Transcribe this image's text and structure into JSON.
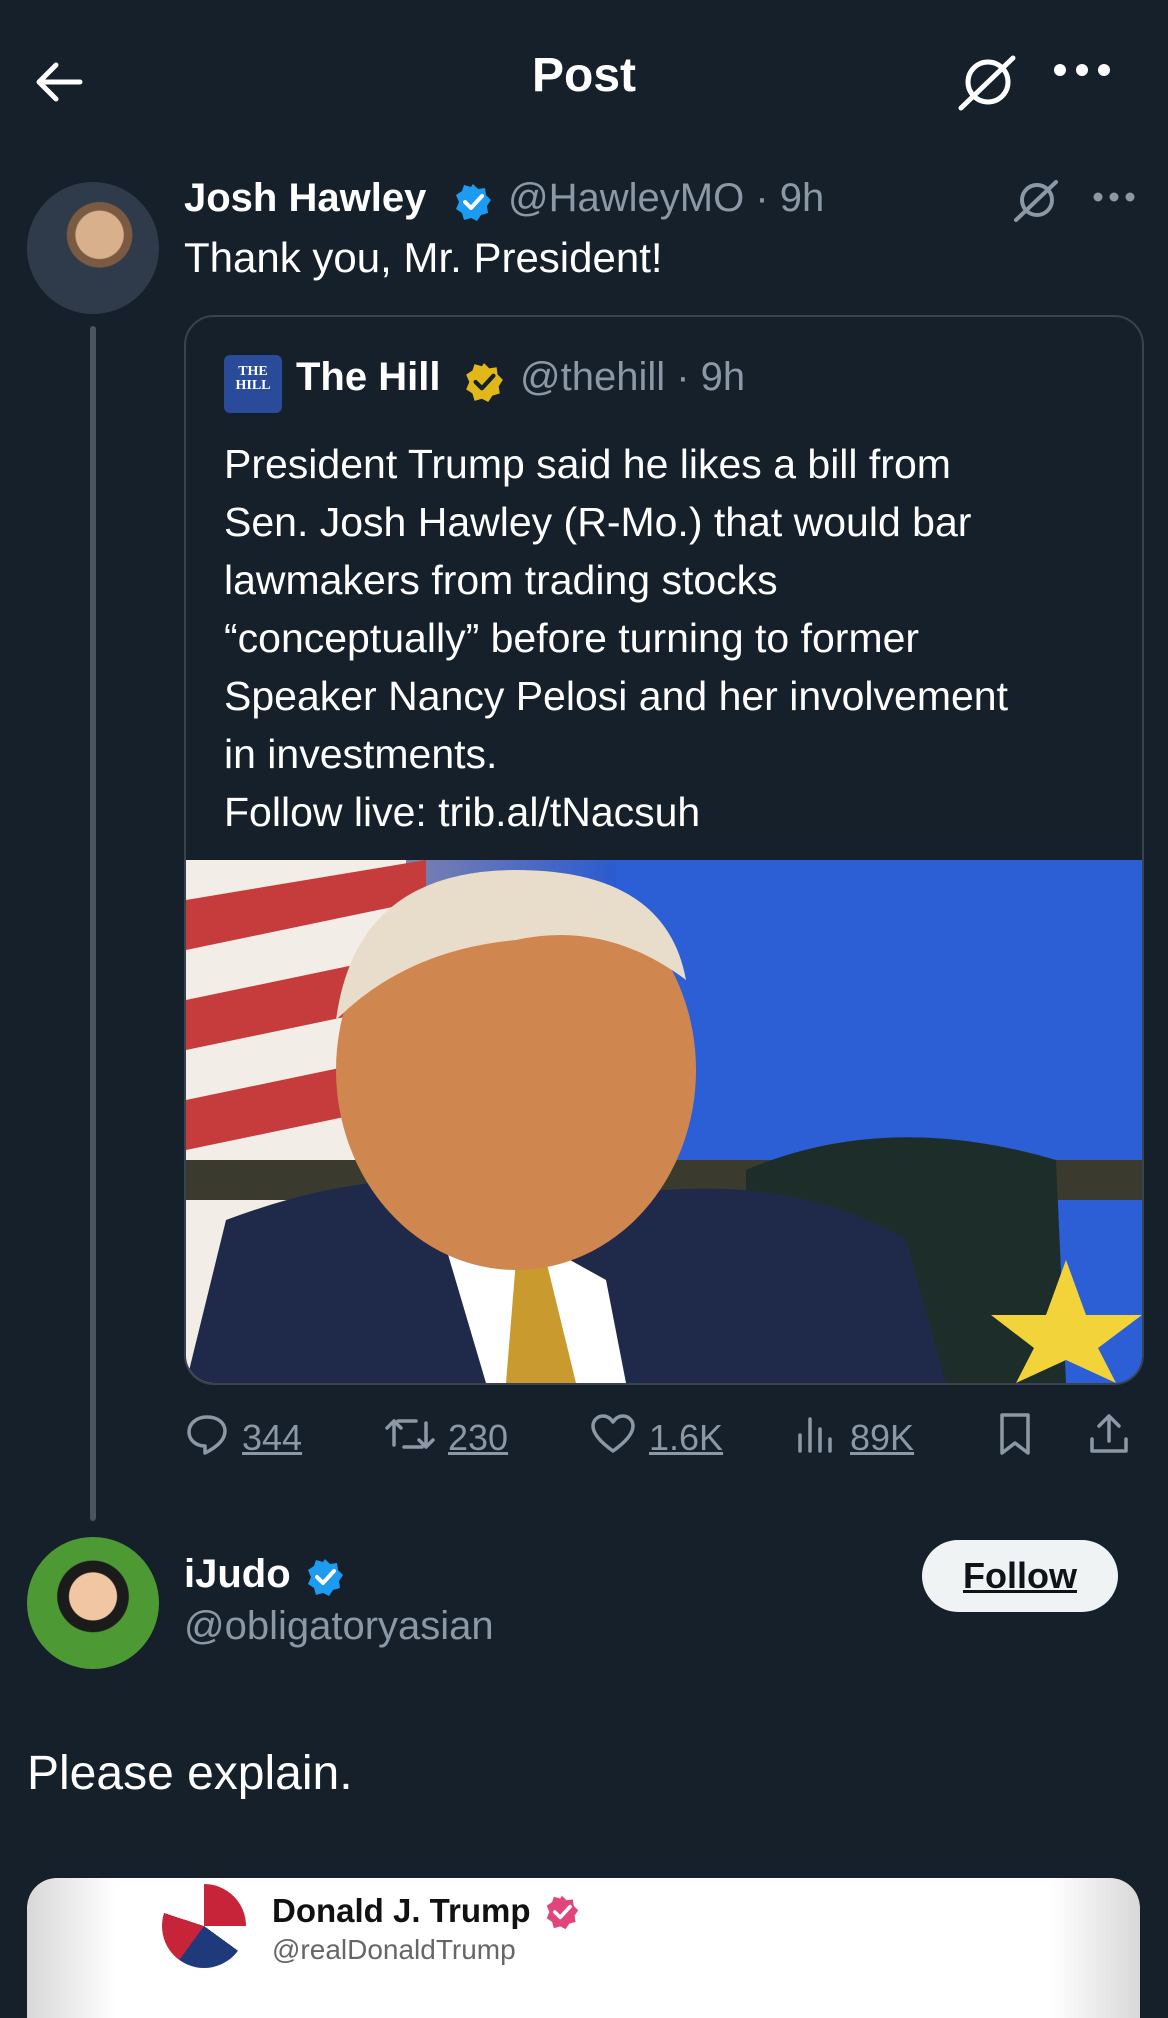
{
  "header": {
    "title": "Post"
  },
  "main_post": {
    "author_name": "Josh Hawley",
    "author_handle": "@HawleyMO",
    "time": "· 9h",
    "text": "Thank you, Mr. President!"
  },
  "quoted_post": {
    "logo_text": "THE HILL",
    "author_name": "The Hill",
    "author_handle": "@thehill",
    "time": "· 9h",
    "lines": [
      "President Trump said he likes a bill from",
      "Sen. Josh Hawley (R-Mo.) that would bar",
      "lawmakers from trading stocks",
      "“conceptually” before turning to former",
      "Speaker Nancy Pelosi and her involvement",
      "in investments.",
      "Follow live: trib.al/tNacsuh"
    ]
  },
  "actions": {
    "replies": "344",
    "reposts": "230",
    "likes": "1.6K",
    "views": "89K"
  },
  "reply": {
    "author_name": "iJudo",
    "author_handle": "@obligatoryasian",
    "follow_label": "Follow",
    "text": "Please explain."
  },
  "embedded": {
    "author_name": "Donald J. Trump",
    "author_handle": "@realDonaldTrump"
  },
  "colors": {
    "background": "#15202b",
    "verified_blue": "#1d9bf0",
    "verified_gold": "#e2b719",
    "muted": "#8b98a5"
  },
  "icons": [
    "back-arrow-icon",
    "grok-icon",
    "more-icon",
    "verified-badge-icon",
    "reply-icon",
    "repost-icon",
    "like-icon",
    "views-icon",
    "bookmark-icon",
    "share-icon"
  ]
}
